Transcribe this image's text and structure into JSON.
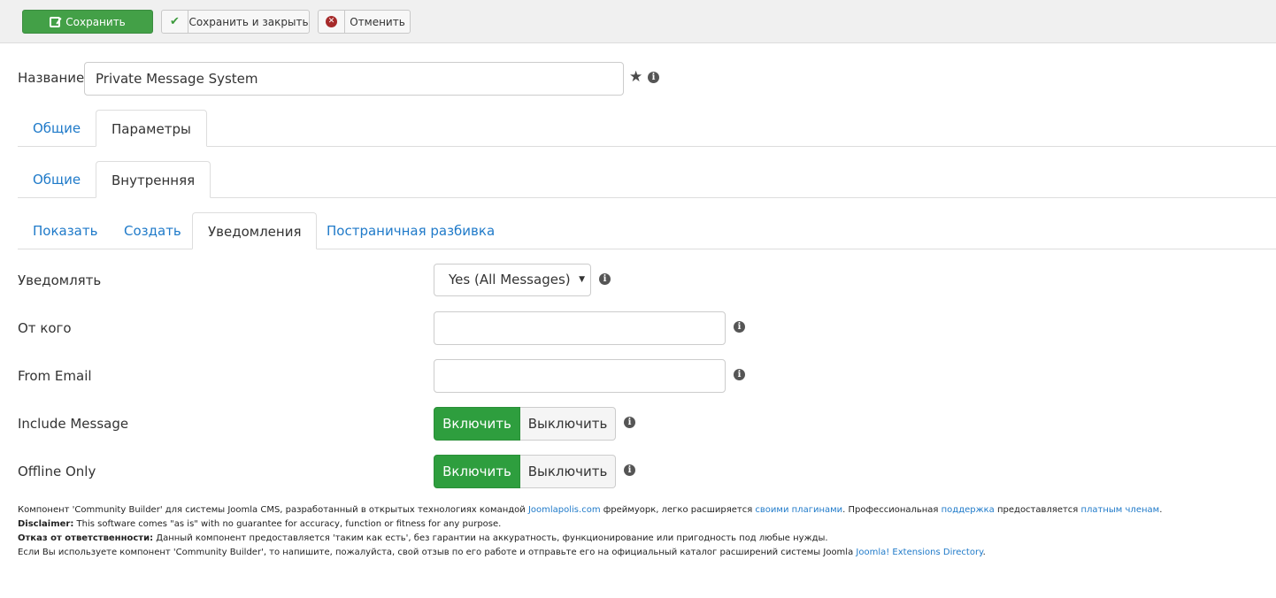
{
  "toolbar": {
    "save_label": "Сохранить",
    "save_close_label": "Сохранить и закрыть",
    "cancel_label": "Отменить"
  },
  "title": {
    "label": "Название",
    "value": "Private Message System"
  },
  "tabs_level1": [
    {
      "label": "Общие",
      "active": false
    },
    {
      "label": "Параметры",
      "active": true
    }
  ],
  "tabs_level2": [
    {
      "label": "Общие",
      "active": false
    },
    {
      "label": "Внутренняя",
      "active": true
    }
  ],
  "tabs_level3": [
    {
      "label": "Показать",
      "active": false
    },
    {
      "label": "Создать",
      "active": false
    },
    {
      "label": "Уведомления",
      "active": true
    },
    {
      "label": "Постраничная разбивка",
      "active": false
    }
  ],
  "fields": {
    "notify": {
      "label": "Уведомлять",
      "value": "Yes (All Messages)"
    },
    "from_name": {
      "label": "От кого",
      "value": ""
    },
    "from_email": {
      "label": "From Email",
      "value": ""
    },
    "include_message": {
      "label": "Include Message",
      "on_label": "Включить",
      "off_label": "Выключить",
      "state": "on"
    },
    "offline_only": {
      "label": "Offline Only",
      "on_label": "Включить",
      "off_label": "Выключить",
      "state": "on"
    }
  },
  "footer": {
    "line1_a": "Компонент 'Community Builder' для системы Joomla CMS, разработанный в открытых технологиях командой ",
    "line1_link1": "Joomlapolis.com",
    "line1_b": " фреймуорк, легко расширяется ",
    "line1_link2": "своими плагинами",
    "line1_c": ". Профессиональная ",
    "line1_link3": "поддержка",
    "line1_d": " предоставляется ",
    "line1_link4": "платным членам",
    "line1_e": ".",
    "line2_bold": "Disclaimer:",
    "line2_text": " This software comes \"as is\" with no guarantee for accuracy, function or fitness for any purpose.",
    "line3_bold": "Отказ от ответственности:",
    "line3_text": " Данный компонент предоставляется 'таким как есть', без гарантии на аккуратность, функционирование или пригодность под любые нужды.",
    "line4_text": "Если Вы используете компонент 'Community Builder', то напишите, пожалуйста, свой отзыв по его работе и отправьте его на официальный каталог расширений системы Joomla ",
    "line4_link": "Joomla! Extensions Directory",
    "line4_end": "."
  },
  "icons": {
    "star": "star-icon",
    "info": "info-icon"
  }
}
